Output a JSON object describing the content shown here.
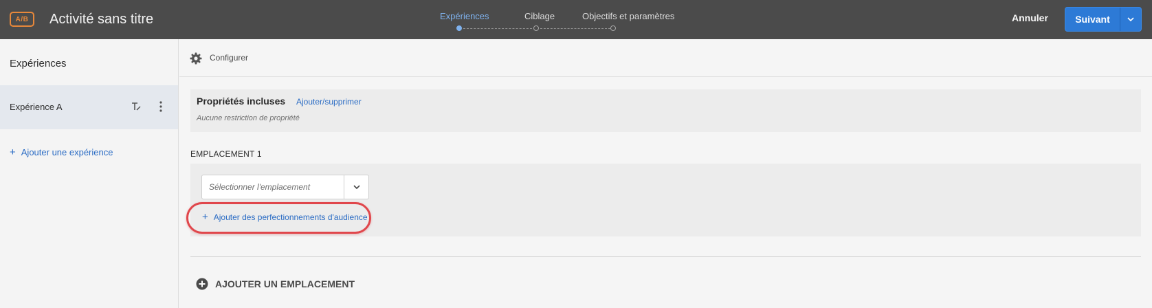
{
  "header": {
    "badge": "A/B",
    "title": "Activité sans titre",
    "steps": [
      {
        "label": "Expériences",
        "active": true
      },
      {
        "label": "Ciblage",
        "active": false
      },
      {
        "label": "Objectifs et paramètres",
        "active": false
      }
    ],
    "cancel_label": "Annuler",
    "next_label": "Suivant",
    "accent_color": "#2d7ad6"
  },
  "sidebar": {
    "title": "Expériences",
    "items": [
      {
        "label": "Expérience A",
        "icons": [
          "rename-icon",
          "more-vertical-icon"
        ]
      }
    ],
    "add_label": "Ajouter une expérience"
  },
  "main": {
    "configure_label": "Configurer",
    "properties": {
      "title": "Propriétés incluses",
      "link": "Ajouter/supprimer",
      "subtitle": "Aucune restriction de propriété"
    },
    "location": {
      "title": "EMPLACEMENT 1",
      "select_placeholder": "Sélectionner l'emplacement",
      "refine_label": "Ajouter des perfectionnements d'audience",
      "highlight_color": "#e0474c"
    },
    "add_location_label": "AJOUTER UN EMPLACEMENT"
  }
}
